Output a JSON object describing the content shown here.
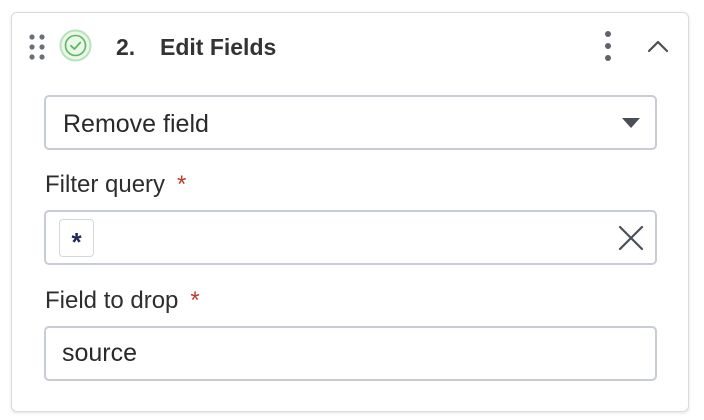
{
  "header": {
    "step_number": "2.",
    "step_title": "Edit Fields",
    "icons": {
      "drag": "drag-handle-icon",
      "status": "check-circle-icon",
      "menu": "kebab-menu-icon",
      "collapse": "chevron-up-icon"
    },
    "status_color": "#5cb85c"
  },
  "action_select": {
    "value": "Remove field"
  },
  "filter_query": {
    "label": "Filter query",
    "required_mark": "*",
    "token": "*"
  },
  "field_to_drop": {
    "label": "Field to drop",
    "required_mark": "*",
    "value": "source"
  },
  "colors": {
    "required": "#c0392b",
    "token_text": "#1f2a5c",
    "border": "#c8ccd4"
  }
}
